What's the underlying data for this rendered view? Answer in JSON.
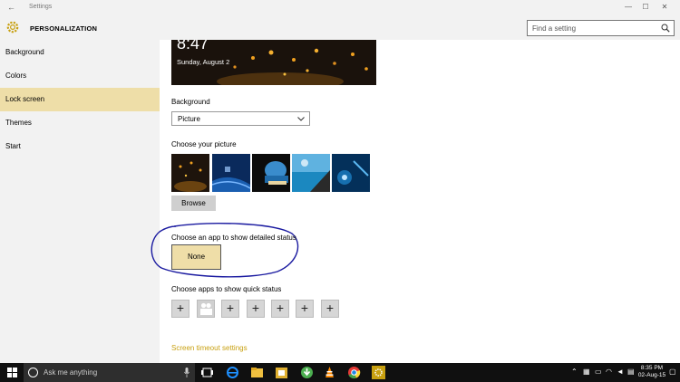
{
  "window": {
    "title": "Settings",
    "controls": [
      "—",
      "☐",
      "✕"
    ]
  },
  "header": {
    "title": "PERSONALIZATION",
    "search_placeholder": "Find a setting"
  },
  "sidebar": {
    "items": [
      {
        "label": "Background",
        "selected": false
      },
      {
        "label": "Colors",
        "selected": false
      },
      {
        "label": "Lock screen",
        "selected": true
      },
      {
        "label": "Themes",
        "selected": false
      },
      {
        "label": "Start",
        "selected": false
      }
    ]
  },
  "preview": {
    "time": "8:47",
    "date": "Sunday, August 2"
  },
  "background": {
    "label": "Background",
    "value": "Picture"
  },
  "picture": {
    "label": "Choose your picture",
    "browse_label": "Browse"
  },
  "detailed_status": {
    "label": "Choose an app to show detailed status",
    "value": "None"
  },
  "quick_status": {
    "label": "Choose apps to show quick status",
    "plus_label": "+"
  },
  "links": {
    "screen_timeout": "Screen timeout settings"
  },
  "taskbar": {
    "search_placeholder": "Ask me anything",
    "time": "8:35 PM",
    "date": "02-Aug-15"
  },
  "colors": {
    "accent": "#eedea8",
    "link": "#c8a010",
    "taskbar": "#101010"
  }
}
